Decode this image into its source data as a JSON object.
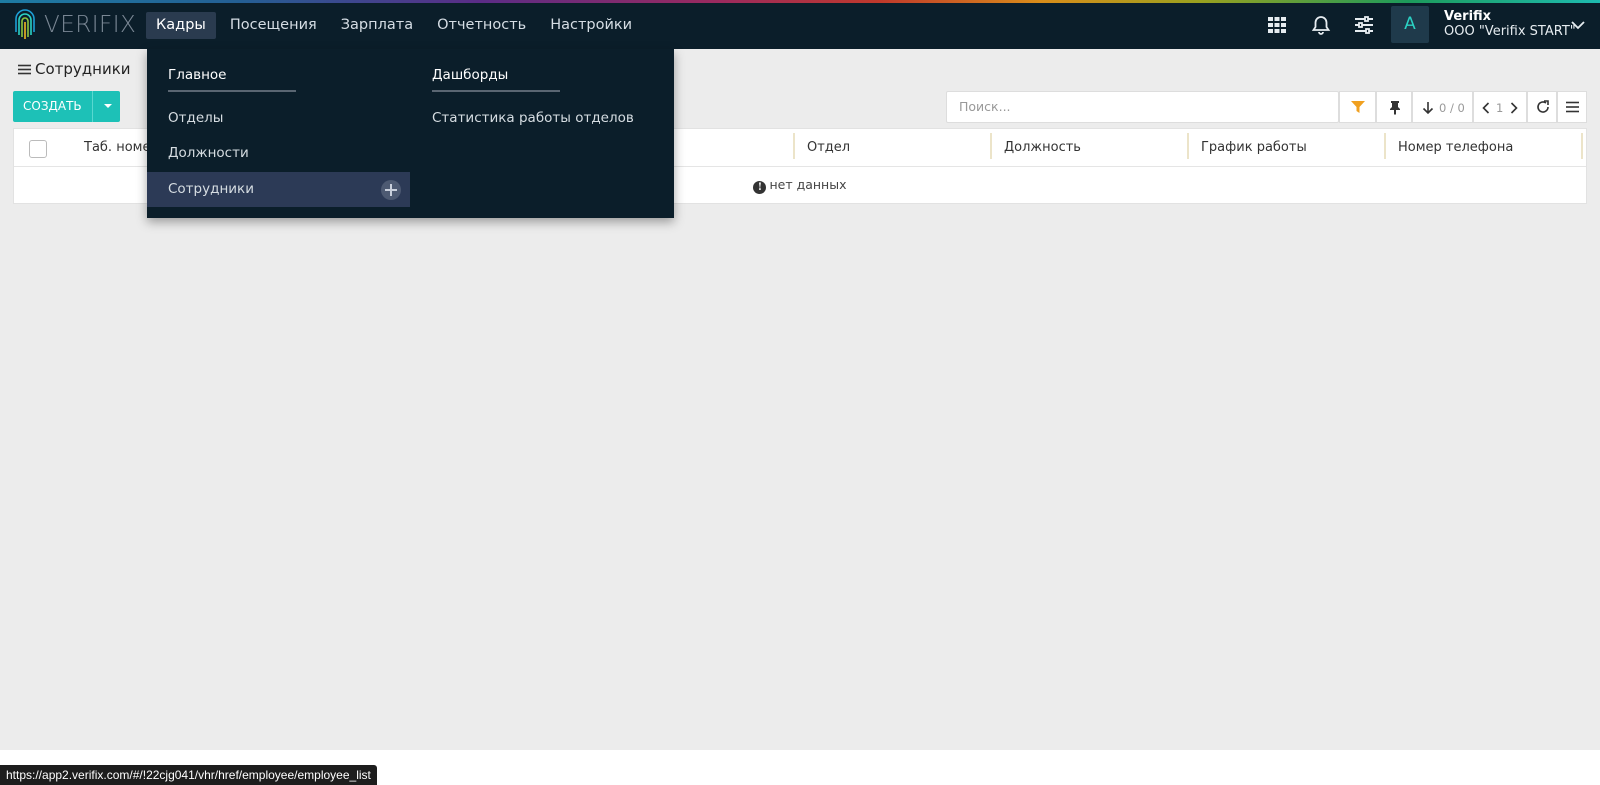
{
  "app": {
    "logo_text": "VERIFIX"
  },
  "nav": {
    "items": [
      {
        "label": "Кадры",
        "active": true
      },
      {
        "label": "Посещения"
      },
      {
        "label": "Зарплата"
      },
      {
        "label": "Отчетность"
      },
      {
        "label": "Настройки"
      }
    ]
  },
  "header_icons": [
    "apps-grid-icon",
    "bell-icon",
    "settings-sliders-icon"
  ],
  "user": {
    "avatar_letter": "A",
    "name": "Verifix",
    "org": "ООО \"Verifix START\""
  },
  "page": {
    "title": "Сотрудники"
  },
  "toolbar": {
    "create_label": "СОЗДАТЬ",
    "search_placeholder": "Поиск...",
    "sort_count": "0 / 0",
    "page_number": "1"
  },
  "table": {
    "columns": [
      "Таб. номе",
      "Отдел",
      "Должность",
      "График работы",
      "Номер телефона"
    ],
    "empty_text": "нет данных"
  },
  "menu": {
    "col1": {
      "heading": "Главное",
      "links": [
        "Отделы",
        "Должности",
        "Сотрудники"
      ]
    },
    "col2": {
      "heading": "Дашборды",
      "links": [
        "Статистика работы отделов"
      ]
    }
  },
  "statusbar": {
    "url": "https://app2.verifix.com/#/!22cjg041/vhr/href/employee/employee_list"
  },
  "colors": {
    "topbar": "#0b1e2a",
    "accent": "#1dc1b7",
    "filter": "#f0a020",
    "menu_highlight": "#2c3a56"
  }
}
